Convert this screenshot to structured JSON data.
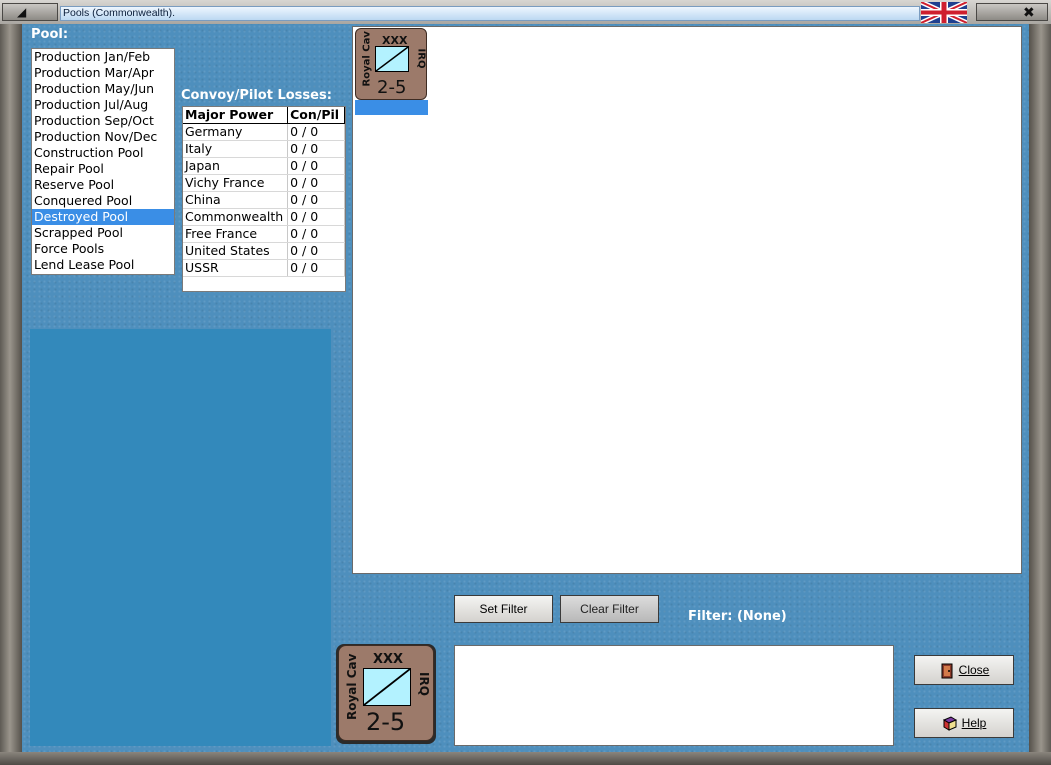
{
  "window": {
    "title": "Pools (Commonwealth)."
  },
  "pool": {
    "label": "Pool:",
    "items": [
      "Production Jan/Feb",
      "Production Mar/Apr",
      "Production May/Jun",
      "Production Jul/Aug",
      "Production Sep/Oct",
      "Production Nov/Dec",
      "Construction Pool",
      "Repair Pool",
      "Reserve Pool",
      "Conquered Pool",
      "Destroyed Pool",
      "Scrapped Pool",
      "Force Pools",
      "Lend Lease Pool"
    ],
    "selected": "Destroyed Pool"
  },
  "losses": {
    "label": "Convoy/Pilot Losses:",
    "headers": [
      "Major Power",
      "Con/Pil"
    ],
    "rows": [
      [
        "Germany",
        "0 / 0"
      ],
      [
        "Italy",
        "0 / 0"
      ],
      [
        "Japan",
        "0 / 0"
      ],
      [
        "Vichy France",
        "0 / 0"
      ],
      [
        "China",
        "0 / 0"
      ],
      [
        "Commonwealth",
        "0 / 0"
      ],
      [
        "Free France",
        "0 / 0"
      ],
      [
        "United States",
        "0 / 0"
      ],
      [
        "USSR",
        "0 / 0"
      ]
    ]
  },
  "unit": {
    "size": "XXX",
    "type": "Royal Cav",
    "nation": "IRQ",
    "strength": "2-5"
  },
  "filter": {
    "set_label": "Set Filter",
    "clear_label": "Clear Filter",
    "label": "Filter:",
    "value": "(None)"
  },
  "buttons": {
    "close_label": "Close",
    "help_label": "Help"
  },
  "colors": {
    "client_bg": "#4e8fbd",
    "selection": "#3a8ee6",
    "counter": "#9c7a6a",
    "unit_symbol": "#b3f2ff"
  }
}
